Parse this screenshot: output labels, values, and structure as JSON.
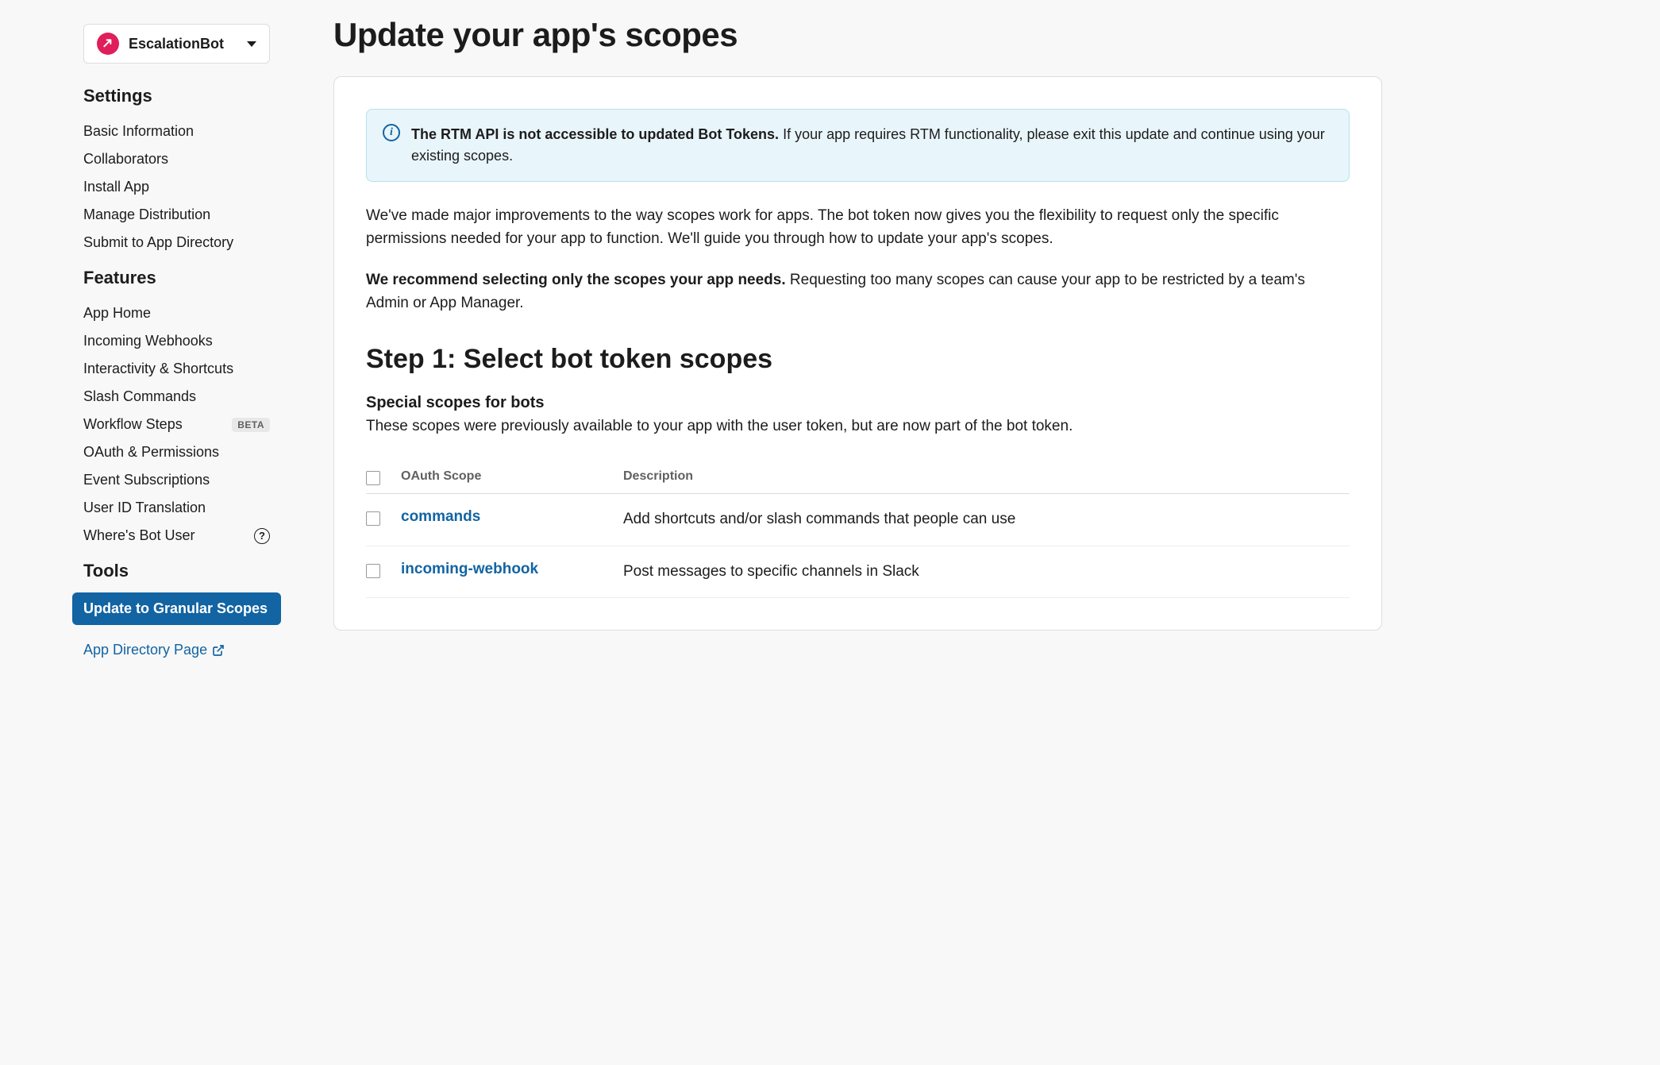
{
  "app_selector": {
    "name": "EscalationBot"
  },
  "sidebar": {
    "sections": [
      {
        "title": "Settings",
        "items": [
          {
            "label": "Basic Information"
          },
          {
            "label": "Collaborators"
          },
          {
            "label": "Install App"
          },
          {
            "label": "Manage Distribution"
          },
          {
            "label": "Submit to App Directory"
          }
        ]
      },
      {
        "title": "Features",
        "items": [
          {
            "label": "App Home"
          },
          {
            "label": "Incoming Webhooks"
          },
          {
            "label": "Interactivity & Shortcuts"
          },
          {
            "label": "Slash Commands"
          },
          {
            "label": "Workflow Steps",
            "badge": "BETA"
          },
          {
            "label": "OAuth & Permissions"
          },
          {
            "label": "Event Subscriptions"
          },
          {
            "label": "User ID Translation"
          },
          {
            "label": "Where's Bot User",
            "help": true
          }
        ]
      },
      {
        "title": "Tools",
        "items": [
          {
            "label": "Update to Granular Scopes",
            "active": true
          }
        ]
      }
    ],
    "link": "App Directory Page"
  },
  "main": {
    "title": "Update your app's scopes",
    "info_bold": "The RTM API is not accessible to updated Bot Tokens.",
    "info_rest": " If your app requires RTM functionality, please exit this update and continue using your existing scopes.",
    "intro": "We've made major improvements to the way scopes work for apps. The bot token now gives you the flexibility to request only the specific permissions needed for your app to function. We'll guide you through how to update your app's scopes.",
    "recommend_bold": "We recommend selecting only the scopes your app needs.",
    "recommend_rest": " Requesting too many scopes can cause your app to be restricted by a team's Admin or App Manager.",
    "step_title": "Step 1: Select bot token scopes",
    "subsection_title": "Special scopes for bots",
    "subsection_desc": "These scopes were previously available to your app with the user token, but are now part of the bot token.",
    "table": {
      "header_scope": "OAuth Scope",
      "header_desc": "Description",
      "rows": [
        {
          "scope": "commands",
          "desc": "Add shortcuts and/or slash commands that people can use"
        },
        {
          "scope": "incoming-webhook",
          "desc": "Post messages to specific channels in Slack"
        }
      ]
    }
  }
}
